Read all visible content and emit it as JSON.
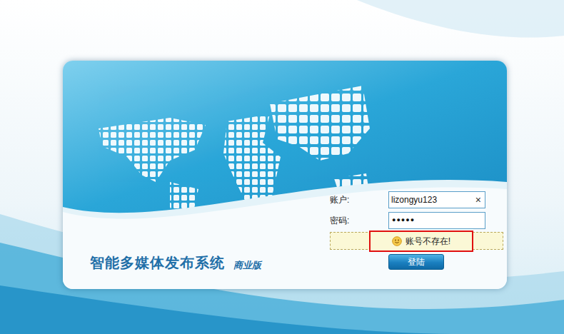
{
  "app": {
    "title": "智能多媒体发布系统",
    "edition": "商业版"
  },
  "login": {
    "account": {
      "label": "账户:",
      "value": "lizongyu123",
      "clear": "×"
    },
    "password": {
      "label": "密码:",
      "value": "●●●●●"
    },
    "error": {
      "message": "账号不存在!",
      "highlighted": true
    },
    "submit": "登陆"
  }
}
